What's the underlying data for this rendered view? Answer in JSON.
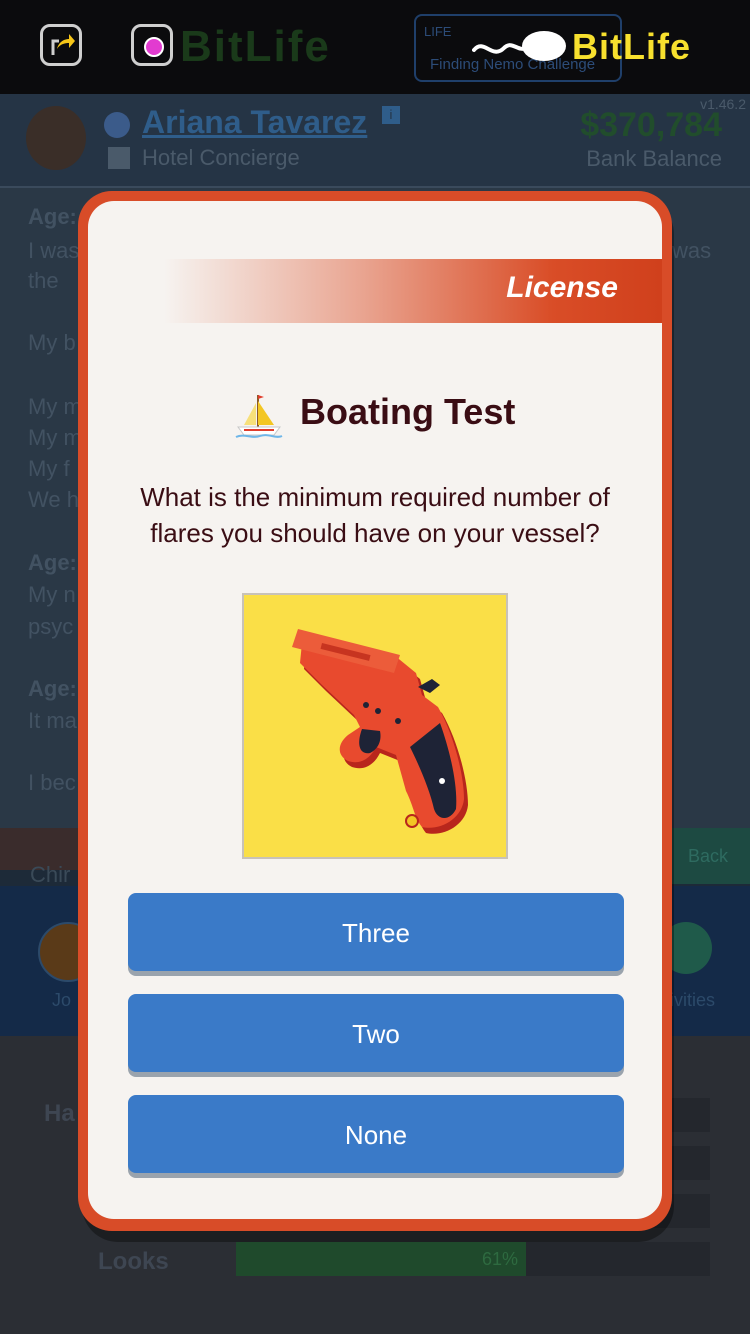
{
  "app": {
    "logo_text": "BitLife",
    "logo_dim_text": "BitLife",
    "challenge_title": "LIFE",
    "challenge_subtitle": "Finding Nemo Challenge",
    "version": "v1.46.2"
  },
  "profile": {
    "name": "Ariana Tavarez",
    "info_badge": "i",
    "job": "Hotel Concierge",
    "balance": "$370,784",
    "balance_label": "Bank Balance"
  },
  "log_fragments": {
    "age1": "Age:",
    "line1": "I was",
    "line2": "the",
    "line3": "My b",
    "line4": "My m",
    "line5": "My m",
    "line6": "My f",
    "line7": "We h",
    "age2": "Age:",
    "line8": "My n",
    "line9": "psyc",
    "age3": "Age:",
    "line10": "It ma",
    "line11": "I bec",
    "right1": "was"
  },
  "midbar": {
    "back_label": "Back",
    "chir_fragment": "Chir"
  },
  "nav": {
    "job_label": "Jo",
    "activities_label": "ivities"
  },
  "stats": {
    "happy_fragment": "Ha",
    "looks_label": "Looks",
    "looks_value": "61%"
  },
  "modal": {
    "ribbon_label": "License",
    "title": "Boating Test",
    "title_icon": "sailboat-icon",
    "question": "What is the minimum required number of flares you should have on your vessel?",
    "picture": "flare-gun-image",
    "answers": [
      "Three",
      "Two",
      "None"
    ]
  },
  "colors": {
    "modal_border": "#d84c28",
    "modal_bg": "#f6f3f0",
    "answer_button": "#3a7ac8",
    "title_text": "#3a0d14",
    "picture_bg": "#fadf47"
  }
}
